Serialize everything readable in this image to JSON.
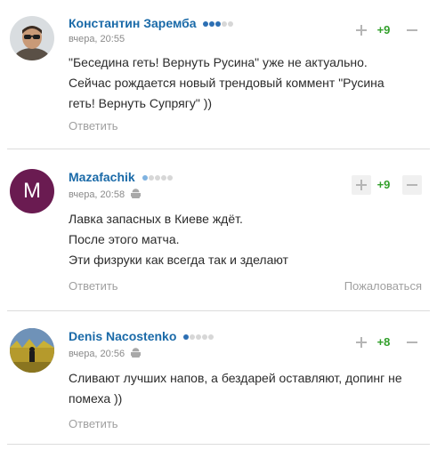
{
  "comments": [
    {
      "author": "Константин Заремба",
      "time": "вчера, 20:55",
      "score": "+9",
      "lines": [
        "\"Беседина геть! Вернуть Русина\" уже не актуально.",
        "Сейчас рождается новый трендовый коммент \"Русина",
        "геть! Вернуть Супрягу\" ))"
      ],
      "reply_label": "Ответить"
    },
    {
      "author": "Mazafachik",
      "avatar_letter": "M",
      "time": "вчера, 20:58",
      "score": "+9",
      "lines": [
        "Лавка запасных в Киеве ждёт.",
        "После этого матча.",
        "Эти физруки как всегда так и зделают"
      ],
      "reply_label": "Ответить",
      "report_label": "Пожаловаться"
    },
    {
      "author": "Denis Nacostenko",
      "time": "вчера, 20:56",
      "score": "+8",
      "lines": [
        "Сливают лучших напов, а бездарей оставляют, допинг не",
        "помеха ))"
      ],
      "reply_label": "Ответить"
    }
  ],
  "colors": {
    "author": "#1a6aa8",
    "score": "#33a02c",
    "muted": "#a0a0a0",
    "avatar_m": "#6a1b51"
  },
  "icons": {
    "upvote": "plus-icon",
    "downvote": "minus-icon",
    "platform": "android-icon"
  }
}
